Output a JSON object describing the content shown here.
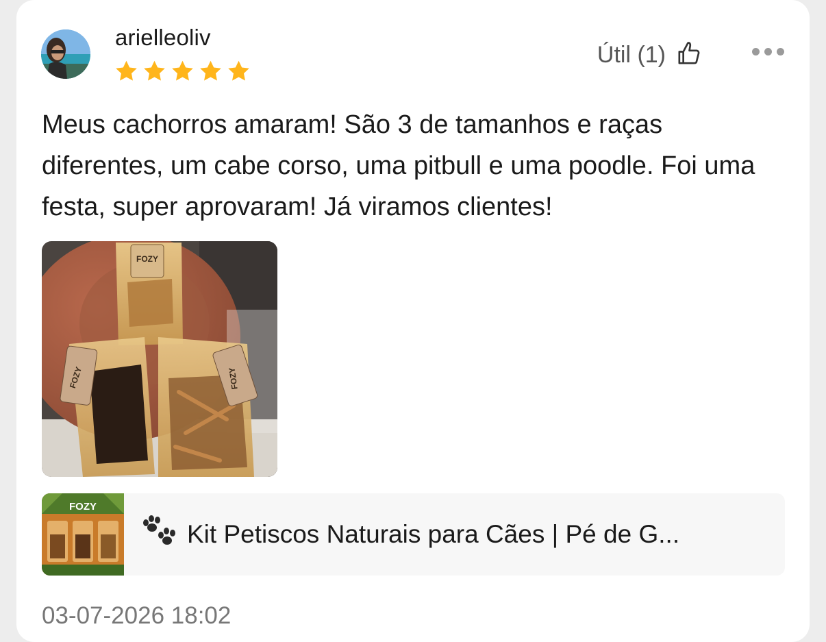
{
  "review": {
    "username": "arielleoliv",
    "rating": 5,
    "rating_max": 5,
    "helpful_label": "Útil (1)",
    "text": "Meus cachorros amaram! São 3 de tamanhos e raças diferentes, um cabe corso, uma pitbull e uma poodle. Foi uma festa, super aprovaram! Já viramos clientes!",
    "timestamp": "03-07-2026 18:02",
    "photo_brand": "FOZY",
    "product": {
      "title": "Kit Petiscos Naturais para Cães | Pé de G...",
      "brand": "FOZY",
      "icon": "paw-prints-icon"
    }
  },
  "colors": {
    "star": "#FFB51B",
    "text": "#1a1a1a",
    "muted": "#777777",
    "card_bg": "#ffffff",
    "page_bg": "#ededed",
    "product_bg": "#f7f7f7"
  },
  "icons": {
    "helpful": "thumbs-up-icon",
    "more": "more-dots-icon",
    "star": "star-icon"
  }
}
